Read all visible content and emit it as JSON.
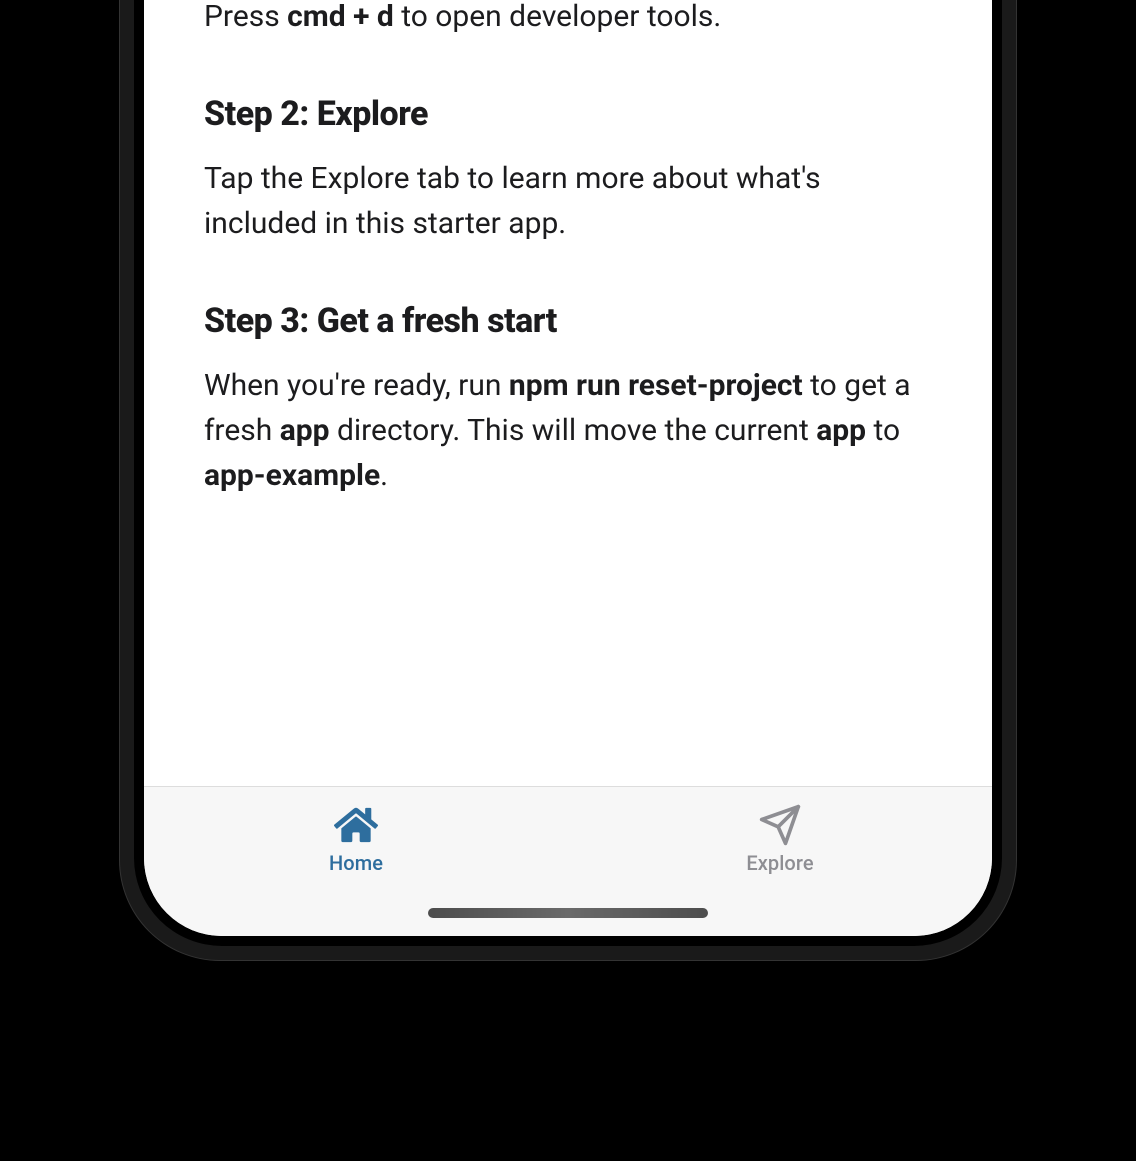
{
  "step1": {
    "body_prefix": "Press ",
    "body_bold": "cmd + d",
    "body_suffix": " to open developer tools."
  },
  "step2": {
    "heading": "Step 2: Explore",
    "body": "Tap the Explore tab to learn more about what's included in this starter app."
  },
  "step3": {
    "heading": "Step 3: Get a fresh start",
    "body_seg1": "When you're ready, run ",
    "body_bold1": "npm run reset-project",
    "body_seg2": " to get a fresh ",
    "body_bold2": "app",
    "body_seg3": " directory. This will move the current ",
    "body_bold3": "app",
    "body_seg4": " to ",
    "body_bold4": "app-example",
    "body_seg5": "."
  },
  "tabs": {
    "home": "Home",
    "explore": "Explore"
  },
  "colors": {
    "active": "#2e6e9e",
    "inactive": "#8e8e93"
  }
}
